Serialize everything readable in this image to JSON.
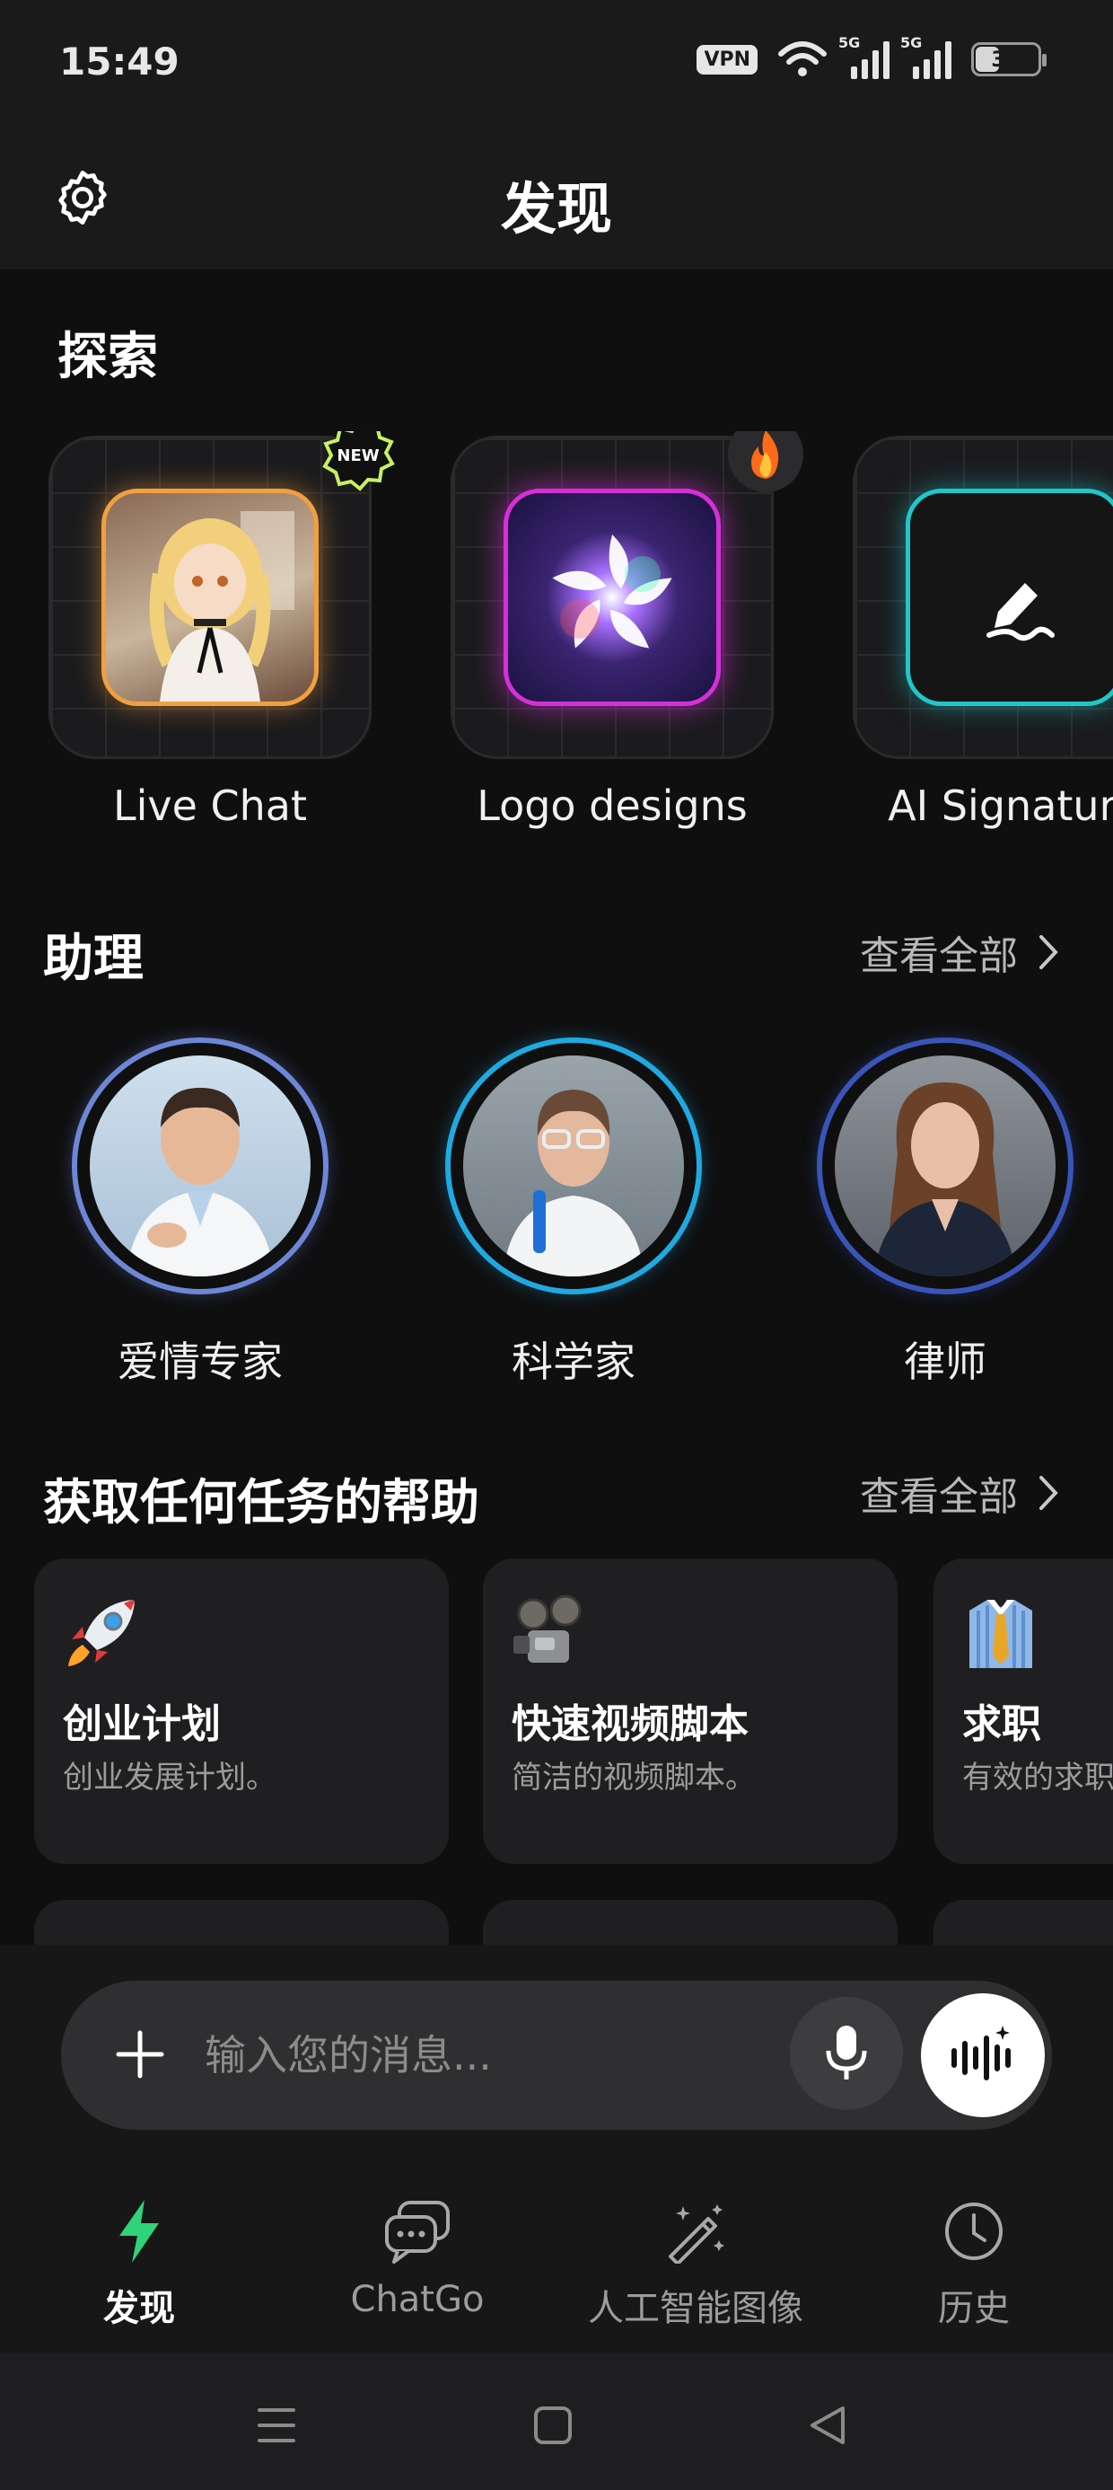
{
  "status": {
    "time": "15:49",
    "vpn": "VPN",
    "net1": "5G",
    "net2": "5G",
    "battery": "30"
  },
  "header": {
    "title": "发现",
    "settings_icon": "gear-icon"
  },
  "explore": {
    "title": "探索",
    "cards": [
      {
        "label": "Live Chat",
        "badge": "NEW",
        "accent": "#f0a040"
      },
      {
        "label": "Logo designs",
        "badge": "fire",
        "accent": "#d530d8"
      },
      {
        "label": "AI Signature",
        "accent": "#1fc7c9"
      }
    ]
  },
  "assistants": {
    "title": "助理",
    "see_all": "查看全部",
    "items": [
      {
        "label": "爱情专家",
        "ring": "#6d86d6"
      },
      {
        "label": "科学家",
        "ring": "#1fa9e0"
      },
      {
        "label": "律师",
        "ring": "#3a55b8"
      }
    ]
  },
  "tasks": {
    "title": "获取任何任务的帮助",
    "see_all": "查看全部",
    "items": [
      {
        "name": "创业计划",
        "desc": "创业发展计划。",
        "icon": "rocket-icon"
      },
      {
        "name": "快速视频脚本",
        "desc": "简洁的视频脚本。",
        "icon": "film-projector-icon"
      },
      {
        "name": "求职",
        "desc": "有效的求职",
        "icon": "shirt-tie-icon"
      }
    ]
  },
  "composer": {
    "placeholder": "输入您的消息..."
  },
  "tabs": [
    {
      "label": "发现",
      "active": true
    },
    {
      "label": "ChatGo",
      "active": false
    },
    {
      "label": "人工智能图像",
      "active": false
    },
    {
      "label": "历史",
      "active": false
    }
  ],
  "colors": {
    "accent_green": "#2fd37a",
    "background": "#0f0f10"
  }
}
